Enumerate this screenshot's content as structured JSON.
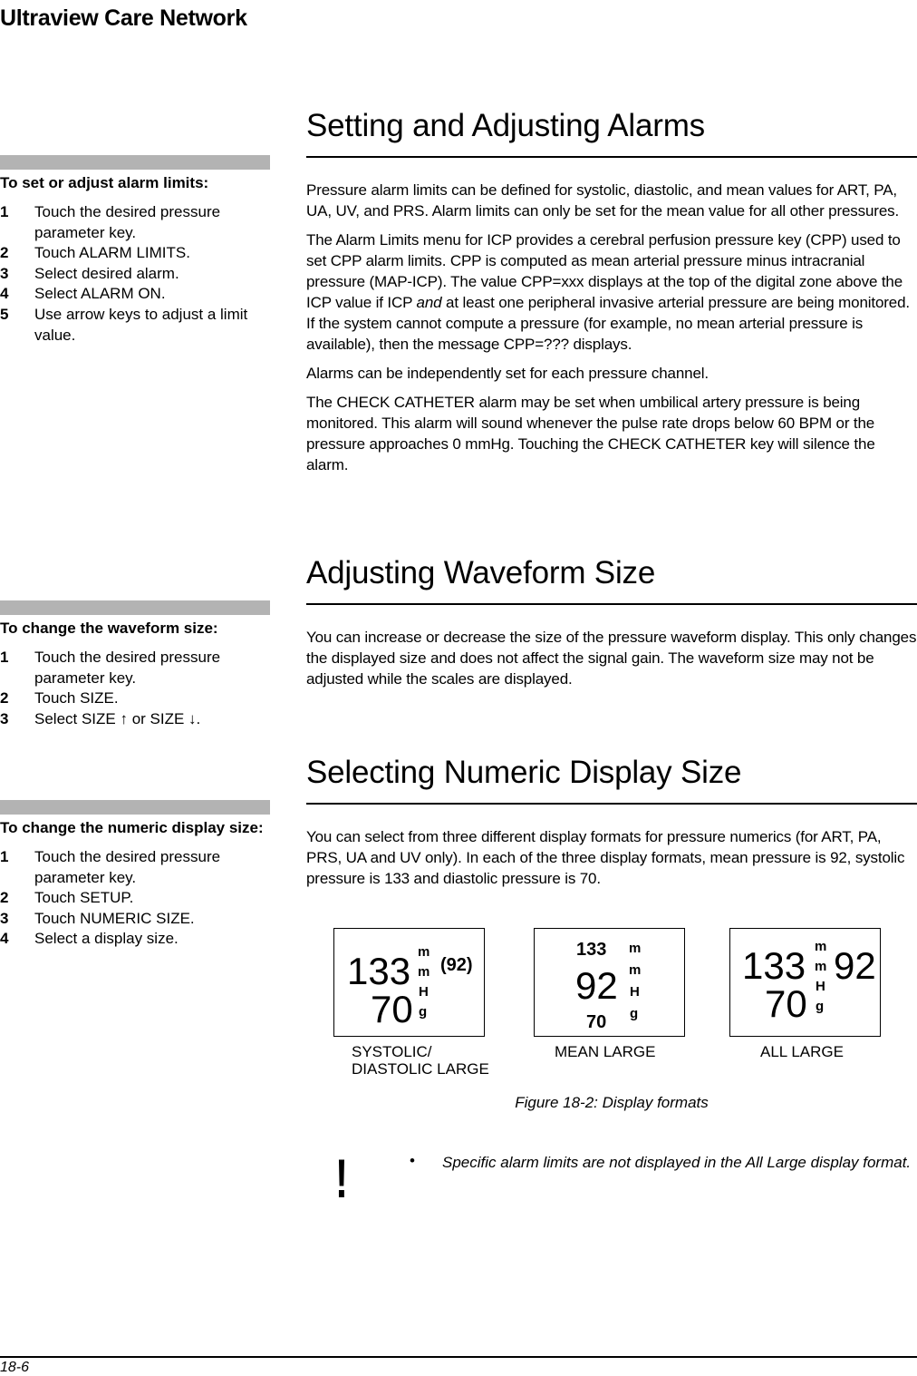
{
  "header": {
    "running_head": "Ultraview Care Network"
  },
  "sidebar": [
    {
      "title": "To set or adjust alarm limits:",
      "steps": [
        {
          "num": "1",
          "text": "Touch the desired pressure parameter key."
        },
        {
          "num": "2",
          "text": "Touch ALARM LIMITS."
        },
        {
          "num": "3",
          "text": "Select desired alarm."
        },
        {
          "num": "4",
          "text": "Select ALARM ON."
        },
        {
          "num": "5",
          "text": "Use arrow keys to adjust a limit value."
        }
      ]
    },
    {
      "title": "To change the waveform size:",
      "steps": [
        {
          "num": "1",
          "text": "Touch the desired pressure parameter key."
        },
        {
          "num": "2",
          "text": "Touch SIZE."
        },
        {
          "num": "3",
          "text": "Select SIZE ↑ or SIZE ↓."
        }
      ]
    },
    {
      "title": "To change the numeric display size:",
      "steps": [
        {
          "num": "1",
          "text": "Touch the desired pressure parameter key."
        },
        {
          "num": "2",
          "text": "Touch SETUP."
        },
        {
          "num": "3",
          "text": "Touch NUMERIC SIZE."
        },
        {
          "num": "4",
          "text": "Select a display size."
        }
      ]
    }
  ],
  "sections": [
    {
      "heading": "Setting and Adjusting Alarms",
      "paragraphs": [
        "Pressure alarm limits can be defined for systolic, diastolic, and mean values for ART, PA, UA, UV, and PRS. Alarm limits can only be set for the mean value for all other pressures.",
        "The Alarm Limits menu for ICP provides a cerebral perfusion pressure key (CPP) used to set CPP alarm limits. CPP is computed as mean arterial pressure minus intracranial pressure (MAP-ICP). The value CPP=xxx displays at the top of the digital zone above the ICP value if ICP ",
        "Alarms can be independently set for each pressure channel.",
        "The CHECK CATHETER alarm may be set when umbilical artery pressure is being monitored. This alarm will sound whenever the pulse rate drops below 60 BPM or the pressure approaches 0 mmHg. Touching the CHECK CATHETER key will silence the alarm."
      ],
      "p2_italic": "and",
      "p2_tail": " at least one peripheral invasive arterial pressure are being monitored. If the system cannot compute a pressure (for example, no mean arterial pressure is available), then the message CPP=??? displays."
    },
    {
      "heading": "Adjusting Waveform Size",
      "paragraphs": [
        "You can increase or decrease the size of the pressure waveform display. This only changes the displayed size and does not affect the signal gain. The waveform size may not be adjusted while the scales are displayed."
      ]
    },
    {
      "heading": "Selecting Numeric Display Size",
      "paragraphs": [
        "You can select from three different display formats for pressure numerics (for ART, PA, PRS, UA and UV only). In each of the three display formats, mean pressure is 92, systolic pressure is 133 and diastolic pressure is 70."
      ]
    }
  ],
  "figure": {
    "values": {
      "systolic": "133",
      "diastolic": "70",
      "mean": "92",
      "mean_paren": "(92)"
    },
    "unit_letters": [
      "m",
      "m",
      "H",
      "g"
    ],
    "formats": [
      {
        "caption_line1": "SYSTOLIC/",
        "caption_line2": "DIASTOLIC LARGE"
      },
      {
        "caption_line1": "MEAN LARGE"
      },
      {
        "caption_line1": "ALL LARGE"
      }
    ],
    "caption": "Figure 18-2: Display formats"
  },
  "note": {
    "icon": "!",
    "bullet": "•",
    "text": "Specific alarm limits are not displayed in the All Large display format."
  },
  "footer": {
    "page_number": "18-6"
  }
}
